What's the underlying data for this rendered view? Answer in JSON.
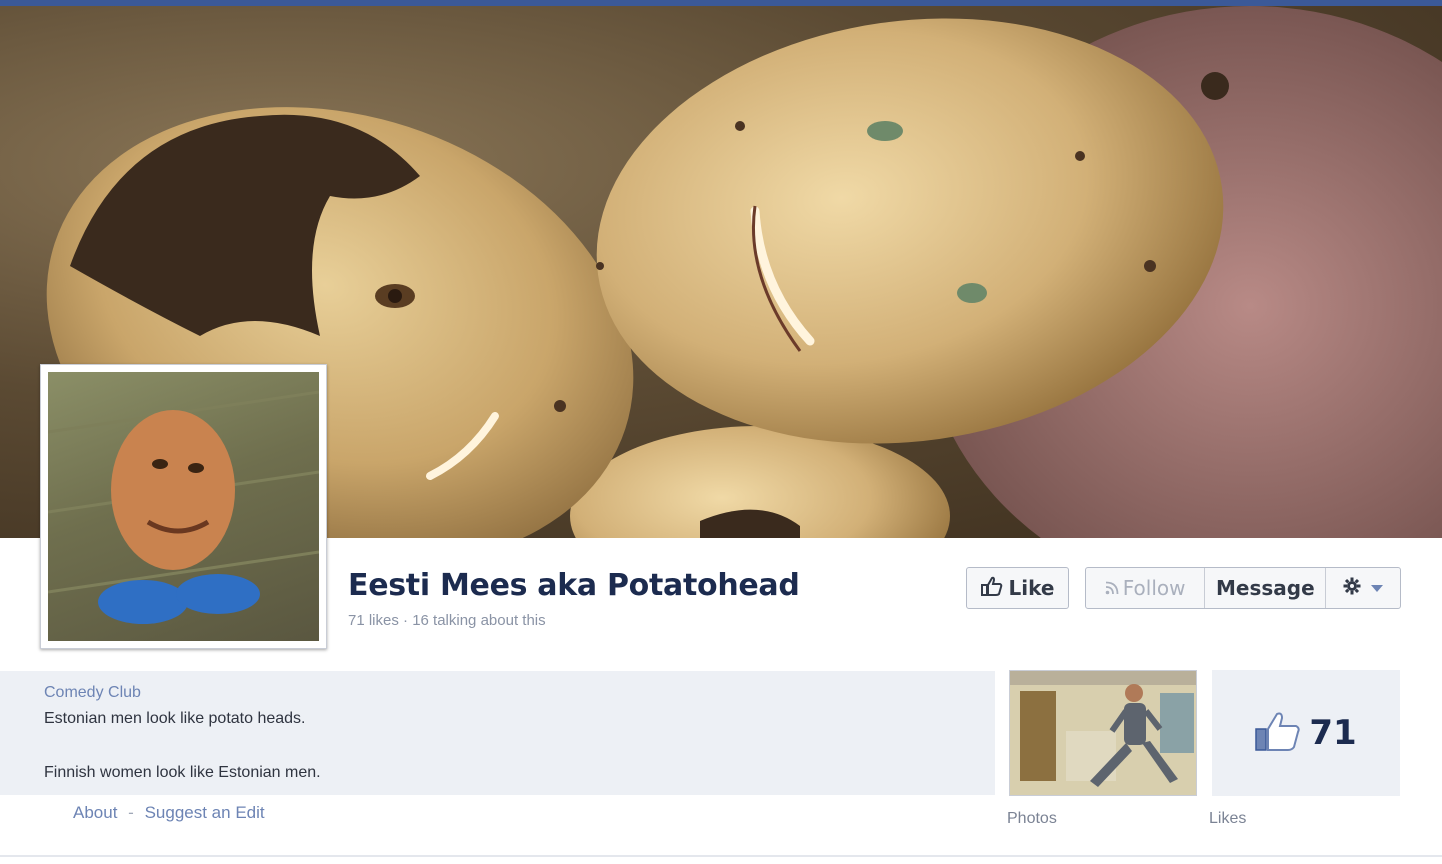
{
  "cover": {
    "image": "cover-photo-potatoes-with-faces"
  },
  "profile": {
    "image": "profile-photo-potatohead-toy"
  },
  "page": {
    "name": "Eesti Mees aka Potatohead",
    "stats": "71 likes · 16 talking about this"
  },
  "actions": {
    "like_label": "Like",
    "follow_label": "Follow",
    "message_label": "Message",
    "like_icon": "thumbs-up-icon",
    "follow_icon": "rss-icon",
    "gear_icon": "gear-icon",
    "dropdown_icon": "caret-down-icon"
  },
  "about": {
    "category": "Comedy Club",
    "line1": "Estonian men look like potato heads.",
    "line2": "Finnish women look like Estonian men.",
    "about_link": "About",
    "separator": "-",
    "suggest_link": "Suggest an Edit"
  },
  "tiles": {
    "photos_label": "Photos",
    "likes_label": "Likes",
    "likes_count": "71"
  },
  "colors": {
    "brand": "#3b5998",
    "link": "#6d84b4",
    "name": "#1c2b4f",
    "panel": "#edf0f5"
  }
}
